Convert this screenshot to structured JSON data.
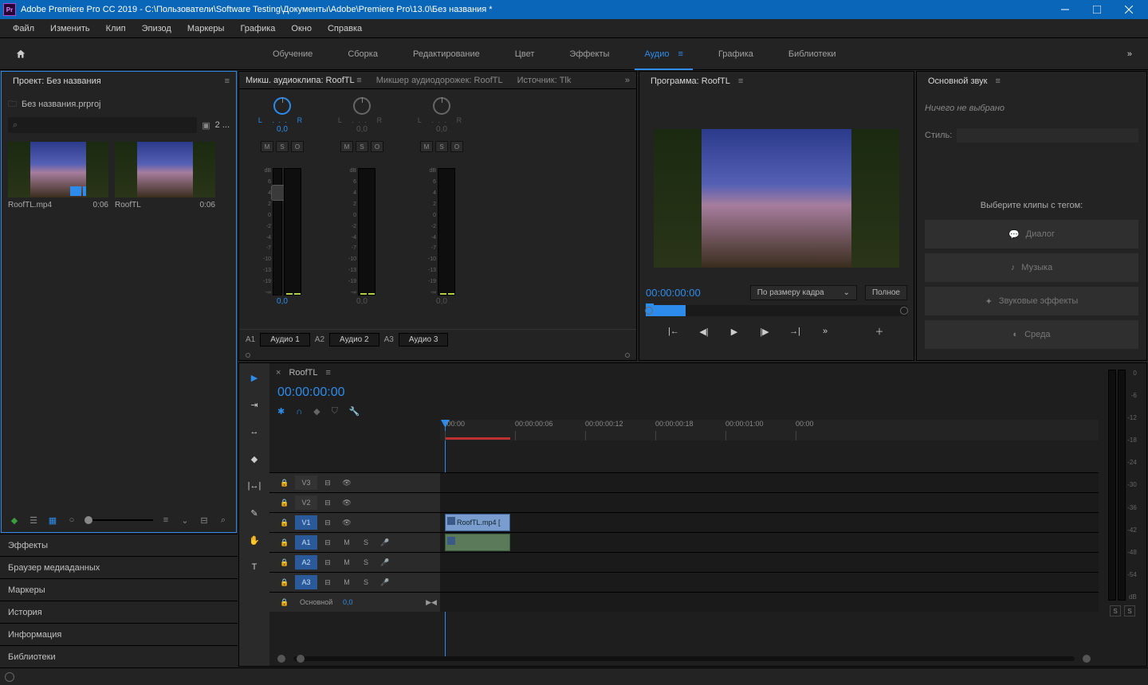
{
  "titlebar": {
    "title": "Adobe Premiere Pro CC 2019 - C:\\Пользователи\\Software Testing\\Документы\\Adobe\\Premiere Pro\\13.0\\Без названия *"
  },
  "menu": [
    "Файл",
    "Изменить",
    "Клип",
    "Эпизод",
    "Маркеры",
    "Графика",
    "Окно",
    "Справка"
  ],
  "workspaces": {
    "items": [
      "Обучение",
      "Сборка",
      "Редактирование",
      "Цвет",
      "Эффекты",
      "Аудио",
      "Графика",
      "Библиотеки"
    ],
    "active": "Аудио"
  },
  "project": {
    "title": "Проект: Без названия",
    "file": "Без названия.prproj",
    "count": "2 ...",
    "clips": [
      {
        "name": "RoofTL.mp4",
        "dur": "0:06"
      },
      {
        "name": "RoofTL",
        "dur": "0:06"
      }
    ]
  },
  "side_panels": [
    "Эффекты",
    "Браузер медиаданных",
    "Маркеры",
    "История",
    "Информация",
    "Библиотеки"
  ],
  "mixer": {
    "tabs": [
      "Микш. аудиоклипа: RoofTL",
      "Микшер аудиодорожек: RoofTL",
      "Источник: Tlk"
    ],
    "channels": [
      {
        "id": "A1",
        "name": "Аудио 1",
        "L": "L",
        "R": "R",
        "pan": "0,0",
        "gain": "0,0",
        "active": true
      },
      {
        "id": "A2",
        "name": "Аудио 2",
        "L": "L",
        "R": "R",
        "pan": "0,0",
        "gain": "0,0",
        "active": false
      },
      {
        "id": "A3",
        "name": "Аудио 3",
        "L": "L",
        "R": "R",
        "pan": "0,0",
        "gain": "0,0",
        "active": false
      }
    ],
    "scale": [
      "dB",
      "6",
      "4",
      "2",
      "0",
      "-2",
      "-4",
      "-7",
      "-10",
      "-13",
      "-19",
      "-∞"
    ],
    "mso": [
      "M",
      "S",
      "O"
    ]
  },
  "program": {
    "title": "Программа: RoofTL",
    "time": "00:00:00:00",
    "fit": "По размеру кадра",
    "full": "Полное"
  },
  "timeline": {
    "seq": "RoofTL",
    "time": "00:00:00:00",
    "ruler": [
      ":00:00",
      "00:00:00:06",
      "00:00:00:12",
      "00:00:00:18",
      "00:00:01:00",
      "00:00"
    ],
    "tracks": {
      "video": [
        "V3",
        "V2",
        "V1"
      ],
      "audio": [
        "A1",
        "A2",
        "A3"
      ],
      "master_label": "Основной",
      "master_val": "0,0"
    },
    "clip_name": "RoofTL.mp4 [",
    "head_btns": {
      "m": "M",
      "s": "S"
    }
  },
  "master_scale": [
    "0",
    "-6",
    "-12",
    "-18",
    "-24",
    "-30",
    "-36",
    "-42",
    "-48",
    "-54",
    "dB"
  ],
  "essential_sound": {
    "title": "Основной звук",
    "empty": "Ничего не выбрано",
    "style_label": "Стиль:",
    "tag_prompt": "Выберите клипы с тегом:",
    "tags": [
      "Диалог",
      "Музыка",
      "Звуковые эффекты",
      "Среда"
    ]
  }
}
